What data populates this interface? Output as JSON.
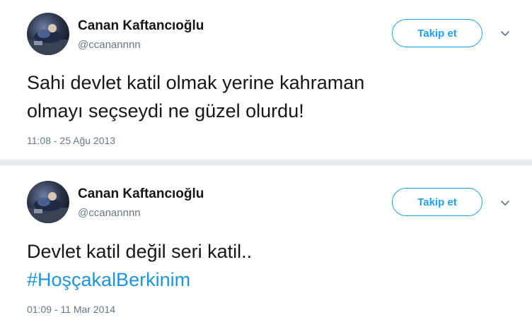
{
  "tweets": [
    {
      "author_name": "Canan Kaftancıoğlu",
      "handle": "@ccanannnn",
      "follow_label": "Takip et",
      "caret_icon": "chevron-down-icon",
      "text_line1": "Sahi devlet katil olmak yerine kahraman",
      "text_line2": "olmayı seçseydi ne güzel olurdu!",
      "timestamp": "11:08 - 25 Ağu 2013"
    },
    {
      "author_name": "Canan Kaftancıoğlu",
      "handle": "@ccanannnn",
      "follow_label": "Takip et",
      "caret_icon": "chevron-down-icon",
      "text_line1": "Devlet katil değil seri katil..",
      "hashtag": "#HoşçakalBerkinim",
      "timestamp": "01:09 - 11 Mar 2014"
    }
  ],
  "colors": {
    "accent": "#1da1f2",
    "hashtag": "#1b95e0",
    "secondary_text": "#657786",
    "primary_text": "#14171a",
    "separator": "#e9ecef"
  }
}
